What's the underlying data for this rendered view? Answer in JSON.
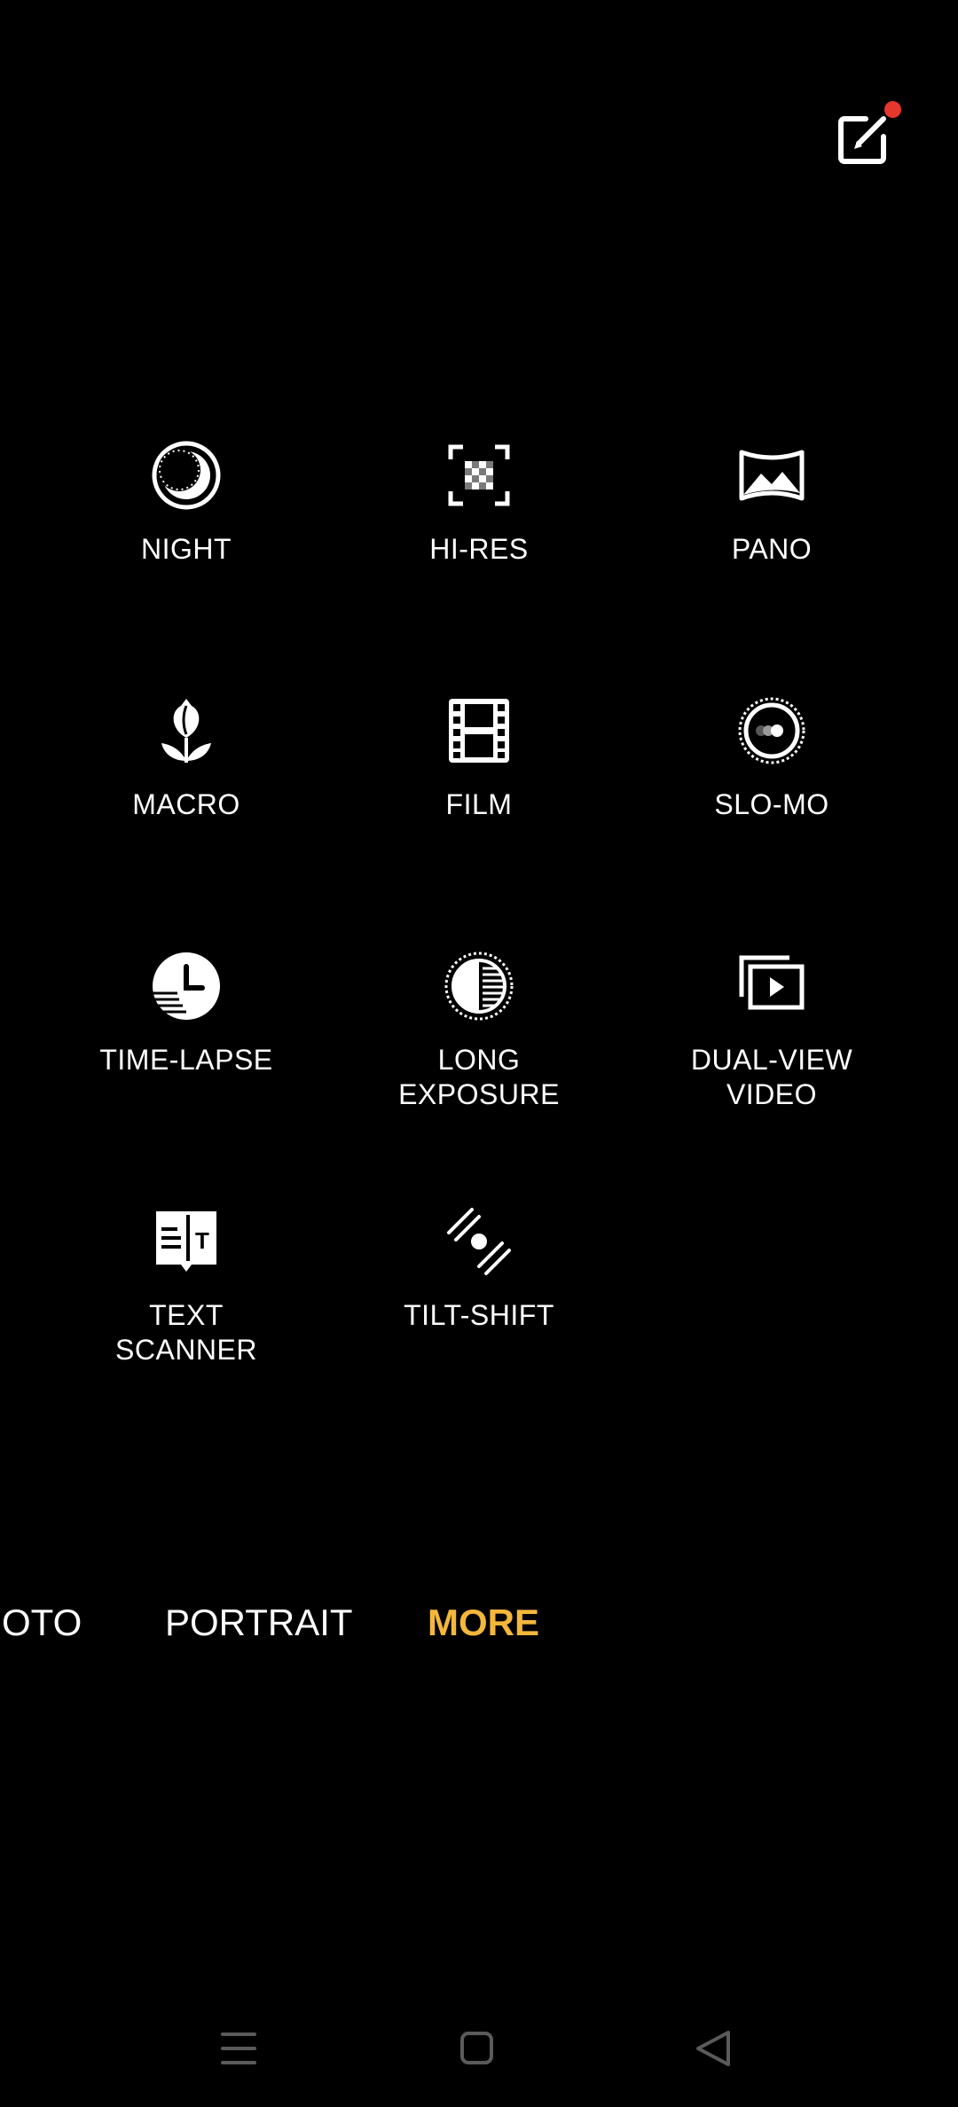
{
  "colors": {
    "background": "#000000",
    "text": "#ffffff",
    "accent": "#f4b73b",
    "notification": "#e5372b",
    "nav_icon": "#5a5a5a"
  },
  "header": {
    "edit_icon": "edit-icon",
    "has_notification": true
  },
  "modes": [
    {
      "label": "NIGHT",
      "icon": "moon-icon"
    },
    {
      "label": "HI-RES",
      "icon": "hi-res-icon"
    },
    {
      "label": "PANO",
      "icon": "panorama-icon"
    },
    {
      "label": "MACRO",
      "icon": "tulip-icon"
    },
    {
      "label": "FILM",
      "icon": "film-icon"
    },
    {
      "label": "SLO-MO",
      "icon": "slow-motion-icon"
    },
    {
      "label": "TIME-LAPSE",
      "icon": "time-lapse-icon"
    },
    {
      "label": "LONG\nEXPOSURE",
      "icon": "long-exposure-icon"
    },
    {
      "label": "DUAL-VIEW\nVIDEO",
      "icon": "dual-view-icon"
    },
    {
      "label": "TEXT\nSCANNER",
      "icon": "text-scanner-icon"
    },
    {
      "label": "TILT-SHIFT",
      "icon": "tilt-shift-icon"
    }
  ],
  "mode_bar": {
    "tabs": [
      {
        "label": "OTO",
        "active": false
      },
      {
        "label": "PORTRAIT",
        "active": false
      },
      {
        "label": "MORE",
        "active": true
      }
    ]
  },
  "nav_bar": {
    "buttons": [
      "menu-icon",
      "home-icon",
      "back-icon"
    ]
  }
}
